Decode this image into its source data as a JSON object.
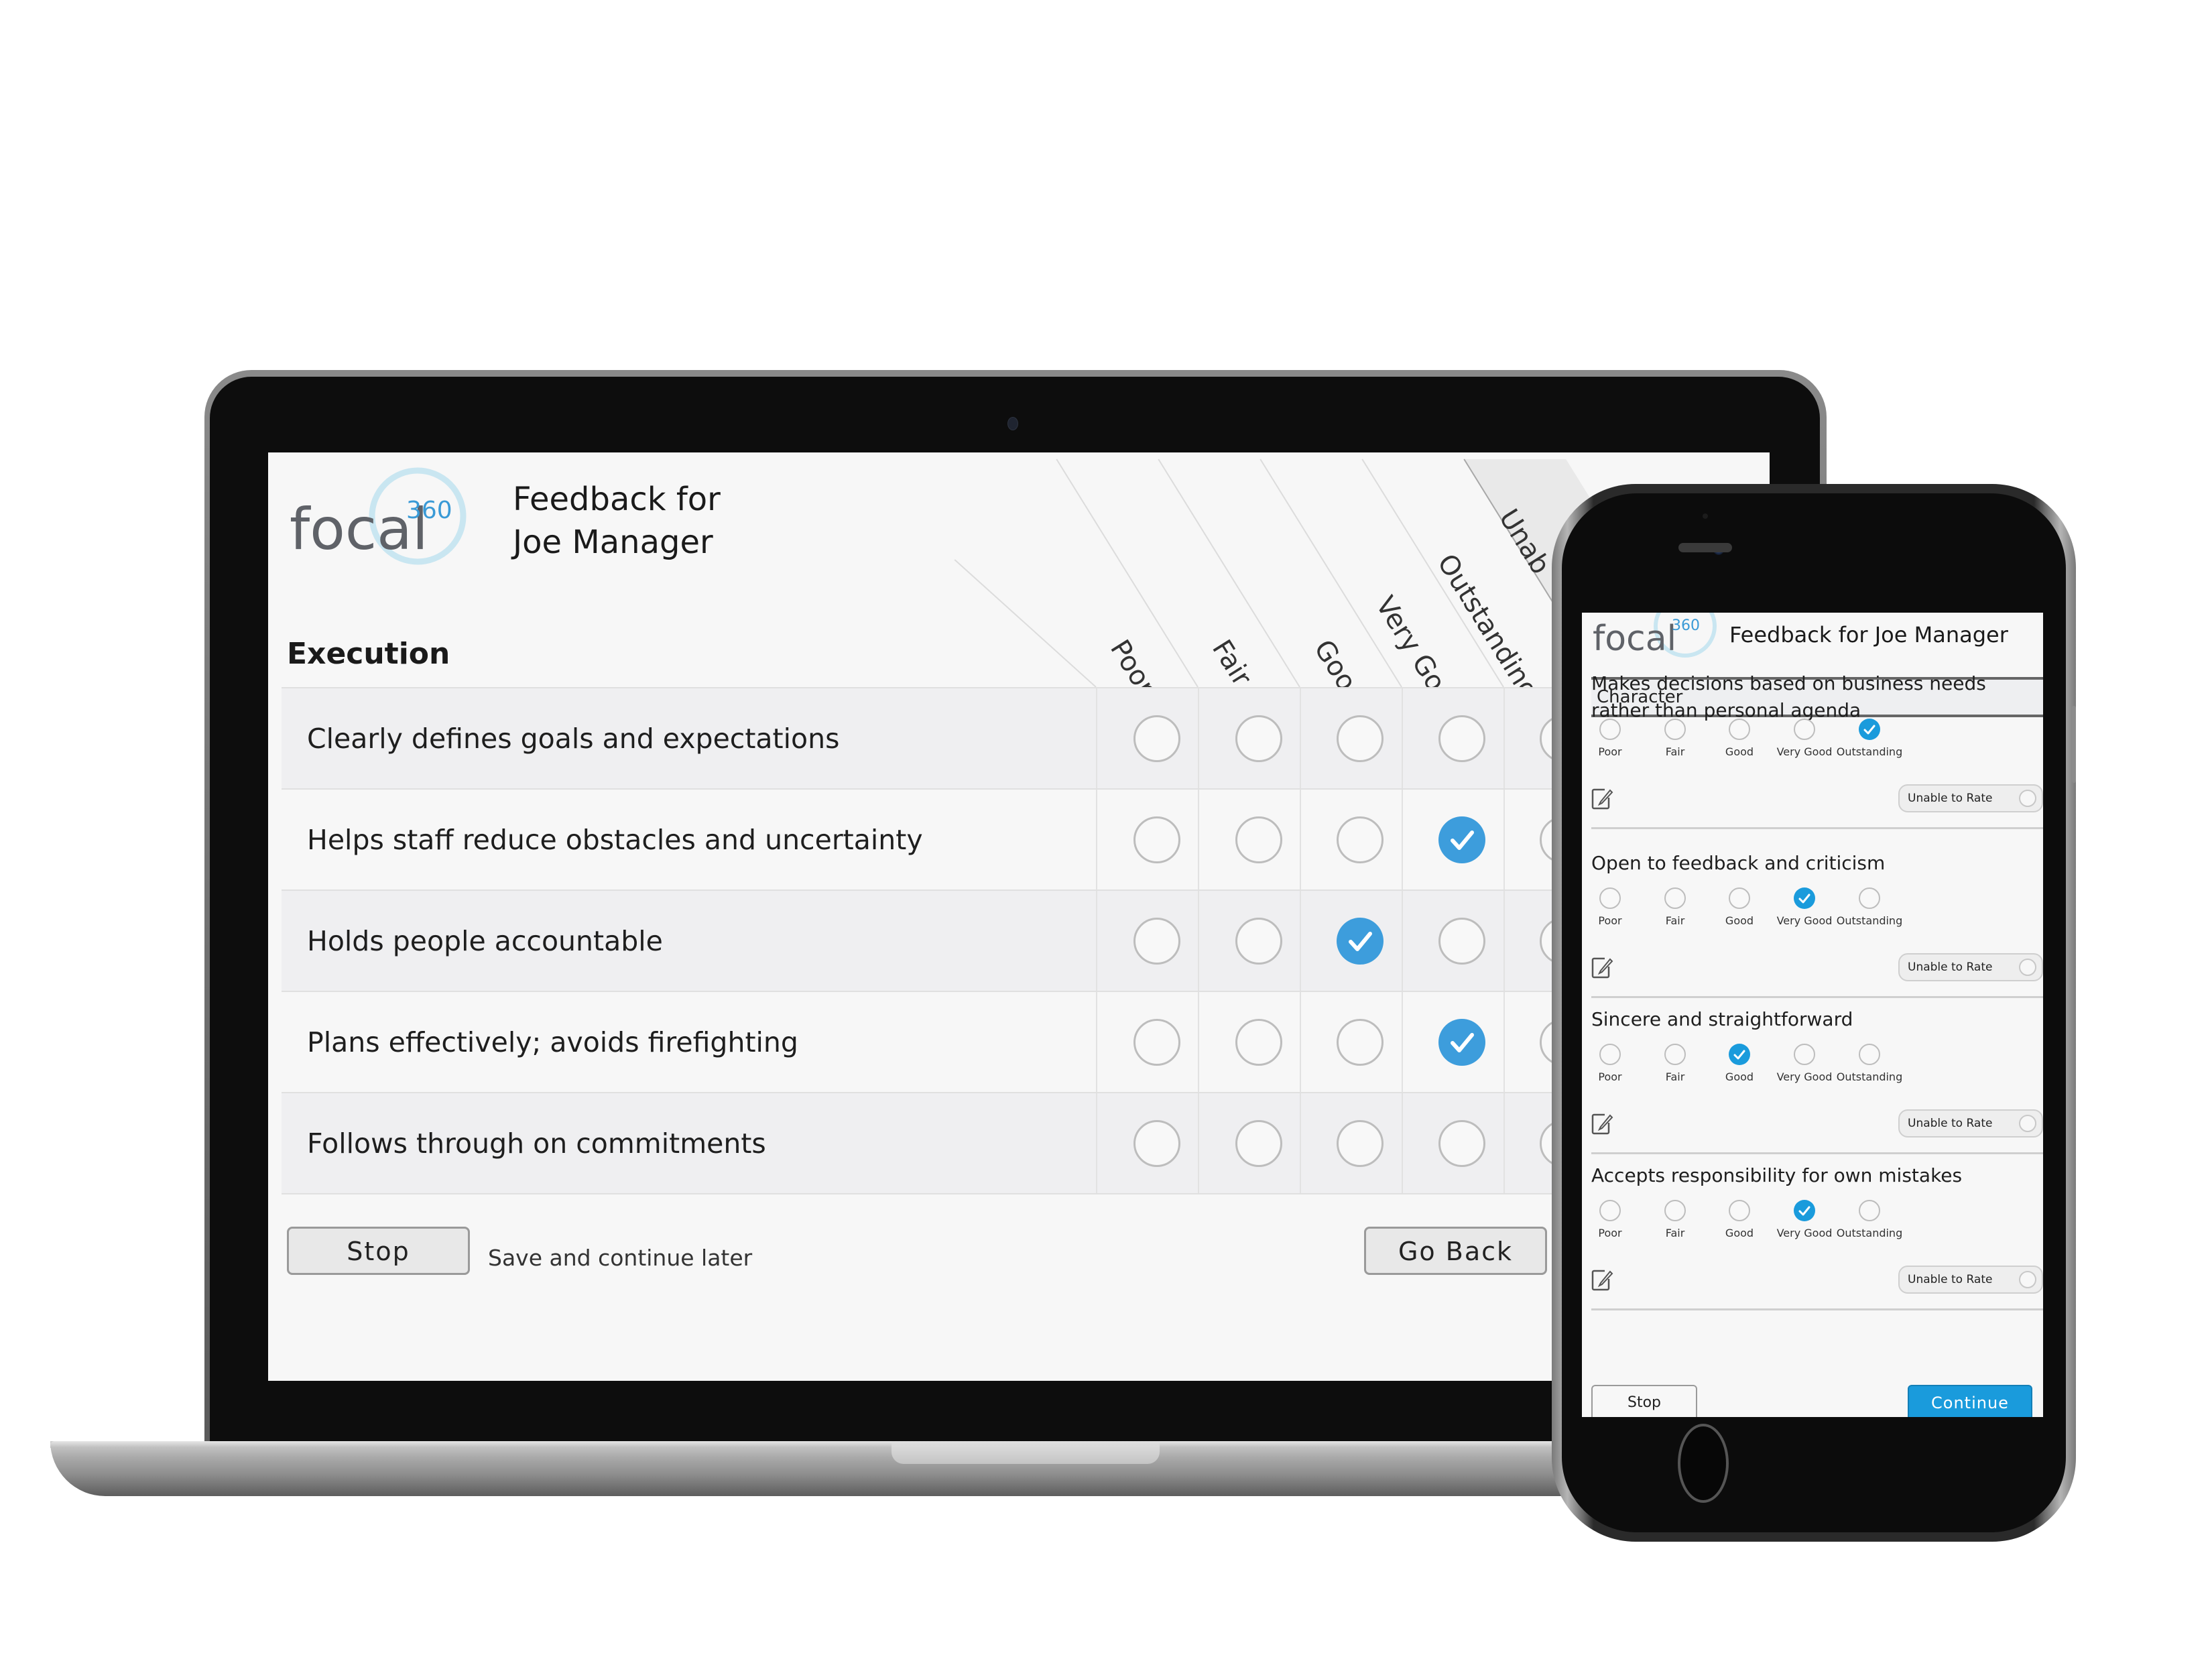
{
  "laptop": {
    "logo": {
      "word": "focal",
      "superscript": "360"
    },
    "title_line1": "Feedback for",
    "title_line2": "Joe Manager",
    "section": "Execution",
    "columns": [
      "Poor",
      "Fair",
      "Good",
      "Very Good",
      "Outstanding",
      "Unable to Rate"
    ],
    "column_visible_labels": [
      "Poor",
      "Fair",
      "Good",
      "Very Good",
      "Outstanding",
      "Unab"
    ],
    "rows": [
      {
        "label": "Clearly defines goals and expectations",
        "selected": "Unable to Rate"
      },
      {
        "label": "Helps staff reduce obstacles and uncertainty",
        "selected": "Very Good"
      },
      {
        "label": "Holds people accountable",
        "selected": "Good"
      },
      {
        "label": "Plans effectively; avoids firefighting",
        "selected": "Very Good"
      },
      {
        "label": "Follows through on commitments",
        "selected": "Unable to Rate"
      }
    ],
    "stop_label": "Stop",
    "save_later_label": "Save and continue later",
    "go_back_label": "Go Back"
  },
  "phone": {
    "logo": {
      "word": "focal",
      "superscript": "360"
    },
    "title": "Feedback for Joe Manager",
    "section": "Character",
    "options": [
      "Poor",
      "Fair",
      "Good",
      "Very Good",
      "Outstanding"
    ],
    "unable_label": "Unable to Rate",
    "questions": [
      {
        "label": "Makes decisions based on business needs rather than personal agenda",
        "selected": "Outstanding",
        "unable": false
      },
      {
        "label": "Open to feedback and criticism",
        "selected": "Very Good",
        "unable": false
      },
      {
        "label": "Sincere and straightforward",
        "selected": "Good",
        "unable": false
      },
      {
        "label": "Accepts responsibility for own mistakes",
        "selected": "Very Good",
        "unable": false
      }
    ],
    "stop_label": "Stop",
    "continue_label": "Continue"
  },
  "colors": {
    "accent": "#3d9ddc",
    "continue_button": "#1a9bdc",
    "logo_text": "#5f6268",
    "logo_ring": "#c9e6f1",
    "logo_superscript": "#3a9ad6"
  },
  "icons": {
    "radio_checked": "check-circle-icon",
    "edit_comment": "edit-note-icon"
  }
}
